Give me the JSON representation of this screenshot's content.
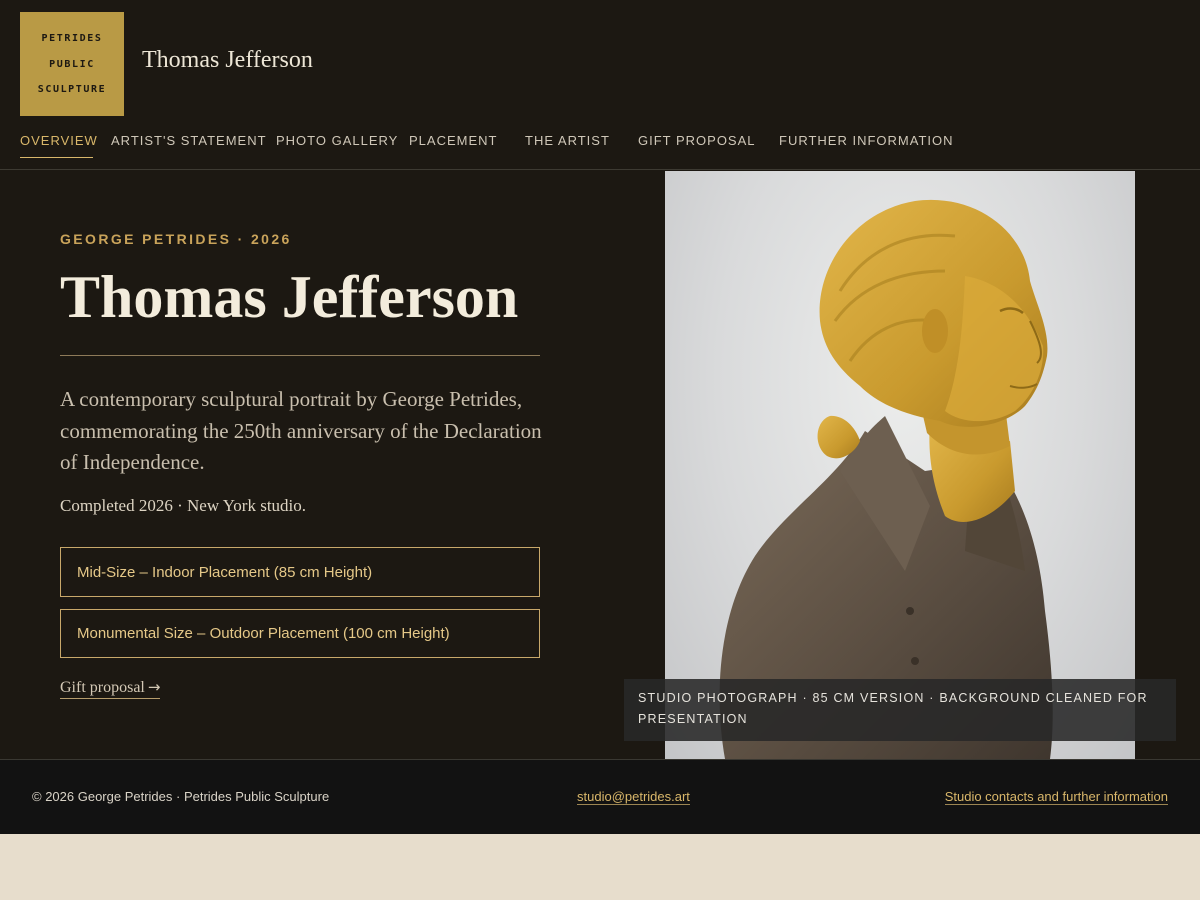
{
  "brand": {
    "logo_lines": [
      "PETRIDES",
      "PUBLIC",
      "SCULPTURE"
    ],
    "site_title": "Thomas Jefferson"
  },
  "nav": {
    "items": [
      "OVERVIEW",
      "ARTIST'S STATEMENT",
      "PHOTO GALLERY",
      "PLACEMENT",
      "THE ARTIST",
      "GIFT PROPOSAL",
      "FURTHER INFORMATION"
    ],
    "active": "OVERVIEW"
  },
  "hero": {
    "kicker": "GEORGE PETRIDES · 2026",
    "title": "Thomas Jefferson",
    "lede": "A contemporary sculptural portrait by George Petrides, commemorating the 250th anniversary of the Declaration of Independence.",
    "meta": "Completed 2026 · New York studio.",
    "options": [
      "Mid-Size – Indoor Placement (85 cm Height)",
      "Monumental Size – Outdoor Placement (100 cm Height)"
    ],
    "gift_link": "Gift proposal",
    "gift_arrow": "→"
  },
  "photo": {
    "caption": "STUDIO PHOTOGRAPH · 85 CM VERSION · BACKGROUND CLEANED FOR PRESENTATION"
  },
  "footer": {
    "copyright": "© 2026 George Petrides · Petrides Public Sculpture",
    "email": "studio@petrides.art",
    "contacts_link": "Studio contacts and further information"
  },
  "colors": {
    "page_bg": "#1c1812",
    "accent_gold": "#d9b76a",
    "logo_gold": "#b99a45",
    "footer_bg": "#121212",
    "below_fold": "#e7ddcc"
  }
}
